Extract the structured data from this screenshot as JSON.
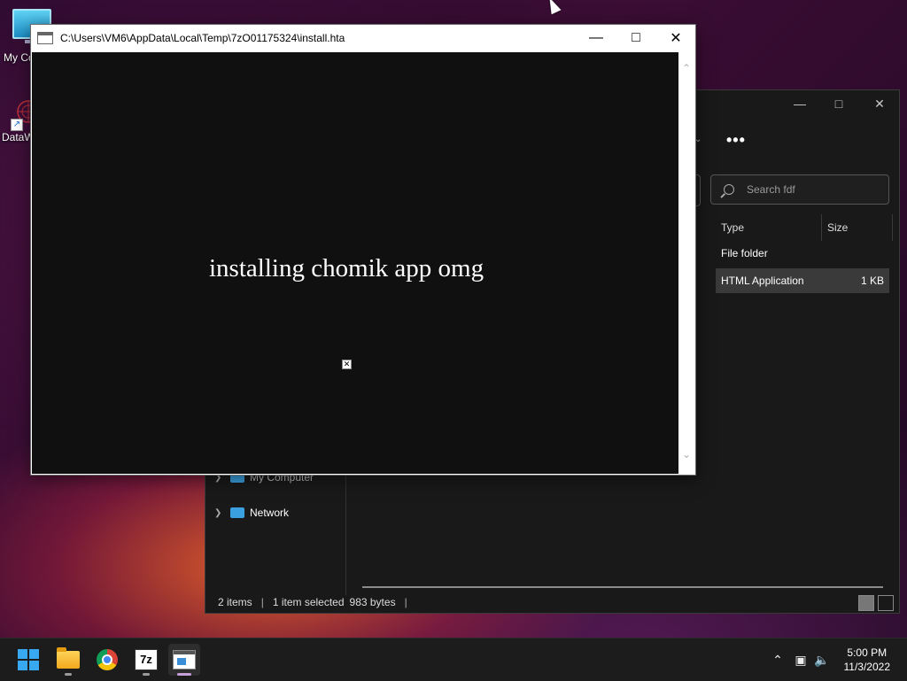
{
  "desktop": {
    "icons": [
      {
        "label": "My Co"
      },
      {
        "label": "DataW"
      }
    ]
  },
  "explorer": {
    "search_placeholder": "Search fdf",
    "more_label": "•••",
    "columns": {
      "type": "Type",
      "size": "Size"
    },
    "rows": [
      {
        "type": "File folder",
        "size": ""
      },
      {
        "type": "HTML Application",
        "size": "1 KB"
      }
    ],
    "nav": {
      "my_computer": "My Computer",
      "network": "Network"
    },
    "status": {
      "items": "2 items",
      "selected": "1 item selected",
      "bytes": "983 bytes"
    }
  },
  "hta": {
    "title": "C:\\Users\\VM6\\AppData\\Local\\Temp\\7zO01175324\\install.hta",
    "message": "installing chomik app omg"
  },
  "taskbar": {
    "apps": [
      "start",
      "file-explorer",
      "chrome",
      "7-zip",
      "install-hta"
    ],
    "clock_time": "5:00 PM",
    "clock_date": "11/3/2022"
  }
}
